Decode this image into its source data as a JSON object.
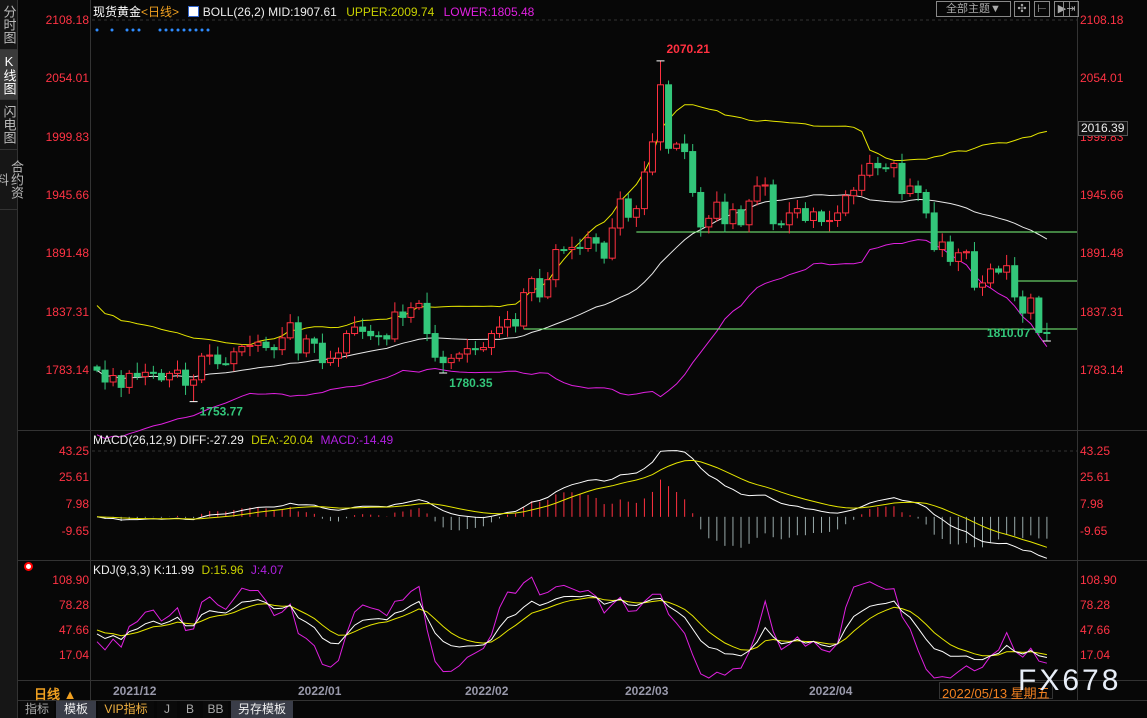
{
  "sidebar": {
    "tabs": [
      {
        "label": "分时图"
      },
      {
        "label": "K线图"
      },
      {
        "label": "闪电图"
      },
      {
        "label": "合约资料"
      }
    ]
  },
  "header": {
    "symbol": "现货黄金",
    "period": "<日线>",
    "boll": "BOLL(26,2)",
    "mid": "MID:1907.61",
    "upper": "UPPER:2009.74",
    "lower": "LOWER:1805.48"
  },
  "toolbar": {
    "theme": "全部主题▼",
    "icons": [
      "crosshair-icon",
      "zoom-range-icon",
      "play-step-icon",
      "scroll-end-icon"
    ]
  },
  "price_axis": [
    "2108.18",
    "2054.01",
    "1999.83",
    "1945.66",
    "1891.48",
    "1837.31",
    "1783.14"
  ],
  "current_price_box": "2016.39",
  "macd": {
    "title": "MACD(26,12,9)",
    "diff": "DIFF:-27.29",
    "dea": "DEA:-20.04",
    "macd": "MACD:-14.49",
    "axis": [
      "43.25",
      "25.61",
      "7.98",
      "-9.65"
    ]
  },
  "kdj": {
    "title": "KDJ(9,3,3)",
    "k": "K:11.99",
    "d": "D:15.96",
    "j": "J:4.07",
    "axis": [
      "108.90",
      "78.28",
      "47.66",
      "17.04"
    ]
  },
  "dates": {
    "period_label": "日线 ▲",
    "labels": [
      "2021/12",
      "2022/01",
      "2022/02",
      "2022/03",
      "2022/04"
    ],
    "cursor": "2022/05/13 星期五"
  },
  "watermark": "FX678",
  "bottom_tabs": [
    "指标",
    "模板",
    "VIP指标",
    "J",
    "B",
    "BB",
    "另存模板"
  ],
  "colors": {
    "up": "#ff3040",
    "down": "#33c67a",
    "mid": "#e8e8e8",
    "upper": "#e6e600",
    "lower": "#e020e0",
    "support": "#7cfc7c"
  },
  "chart_data": {
    "type": "candlestick",
    "closes": [
      1783,
      1772,
      1778,
      1767,
      1780,
      1777,
      1781,
      1780,
      1774,
      1780,
      1783,
      1769,
      1774,
      1796,
      1797,
      1789,
      1789,
      1800,
      1805,
      1806,
      1809,
      1804,
      1802,
      1813,
      1827,
      1799,
      1812,
      1808,
      1790,
      1794,
      1799,
      1817,
      1823,
      1819,
      1815,
      1815,
      1812,
      1837,
      1832,
      1841,
      1845,
      1817,
      1795,
      1790,
      1794,
      1798,
      1803,
      1802,
      1804,
      1817,
      1823,
      1830,
      1824,
      1855,
      1868,
      1851,
      1867,
      1895,
      1895,
      1897,
      1896,
      1906,
      1901,
      1887,
      1915,
      1942,
      1925,
      1933,
      1967,
      1995,
      2048,
      1989,
      1993,
      1986,
      1948,
      1916,
      1924,
      1939,
      1919,
      1932,
      1918,
      1940,
      1954,
      1955,
      1919,
      1918,
      1929,
      1933,
      1922,
      1930,
      1921,
      1922,
      1929,
      1945,
      1950,
      1964,
      1975,
      1971,
      1971,
      1975,
      1947,
      1954,
      1948,
      1929,
      1895,
      1902,
      1884,
      1892,
      1893,
      1860,
      1864,
      1877,
      1874,
      1880,
      1851,
      1836,
      1850,
      1818,
      1818
    ],
    "extremes": [
      {
        "index": 12,
        "type": "low",
        "value": 1753.77,
        "label": "1753.77"
      },
      {
        "index": 43,
        "type": "low",
        "value": 1780.35,
        "label": "1780.35"
      },
      {
        "index": 70,
        "type": "high",
        "value": 2070.21,
        "label": "2070.21"
      },
      {
        "index": 118,
        "type": "low",
        "value": 1810.07,
        "label": "1810.07"
      }
    ],
    "support_levels": [
      {
        "price": 1911.3,
        "from_index": 67
      },
      {
        "price": 1865.8,
        "from_index": 114
      },
      {
        "price": 1821.2,
        "from_index": 53
      }
    ],
    "yrange": [
      1783.14,
      2108.18
    ]
  }
}
